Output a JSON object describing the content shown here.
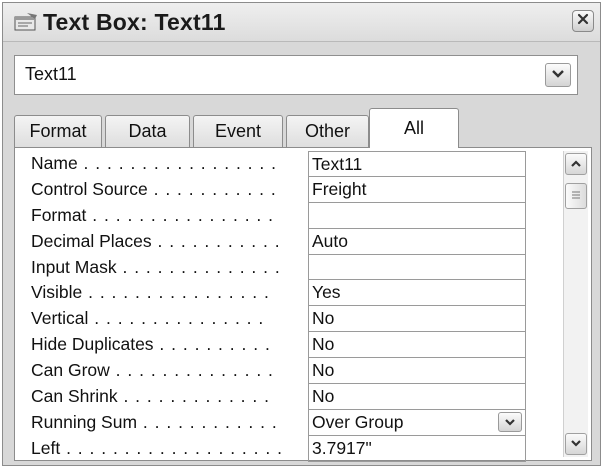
{
  "window": {
    "title": "Text Box: Text11"
  },
  "icons": {
    "title": "property-sheet-icon",
    "close": "close-icon",
    "dropdown": "chevron-down-icon",
    "scroll_up": "chevron-up-icon",
    "scroll_down": "chevron-down-icon",
    "thumb": "grip-icon"
  },
  "selector": {
    "value": "Text11"
  },
  "tabs": [
    {
      "label": "Format",
      "active": false
    },
    {
      "label": "Data",
      "active": false
    },
    {
      "label": "Event",
      "active": false
    },
    {
      "label": "Other",
      "active": false
    },
    {
      "label": "All",
      "active": true
    }
  ],
  "properties": [
    {
      "name": "Name",
      "dots": " . . . . . . . . . . . . . . . . .",
      "value": "Text11"
    },
    {
      "name": "Control Source",
      "dots": " . . . . . . . . . . .",
      "value": "Freight"
    },
    {
      "name": "Format",
      "dots": " . . . . . . . . . . . . . . . .",
      "value": ""
    },
    {
      "name": "Decimal Places",
      "dots": " . . . . . . . . . . .",
      "value": "Auto"
    },
    {
      "name": "Input Mask",
      "dots": " . . . . . . . . . . . . . .",
      "value": ""
    },
    {
      "name": "Visible",
      "dots": " . . . . . . . . . . . . . . . .",
      "value": "Yes"
    },
    {
      "name": "Vertical",
      "dots": " . . . . . . . . . . . . . . .",
      "value": "No"
    },
    {
      "name": "Hide Duplicates",
      "dots": " . . . . . . . . . .",
      "value": "No"
    },
    {
      "name": "Can Grow",
      "dots": " . . . . . . . . . . . . . .",
      "value": "No"
    },
    {
      "name": "Can Shrink",
      "dots": " . . . . . . . . . . . . .",
      "value": "No"
    },
    {
      "name": "Running Sum",
      "dots": " . . . . . . . . . . . .",
      "value": "Over Group",
      "has_dropdown": true
    },
    {
      "name": "Left",
      "dots": " . . . . . . . . . . . . . . . . . . .",
      "value": "3.7917\""
    }
  ]
}
